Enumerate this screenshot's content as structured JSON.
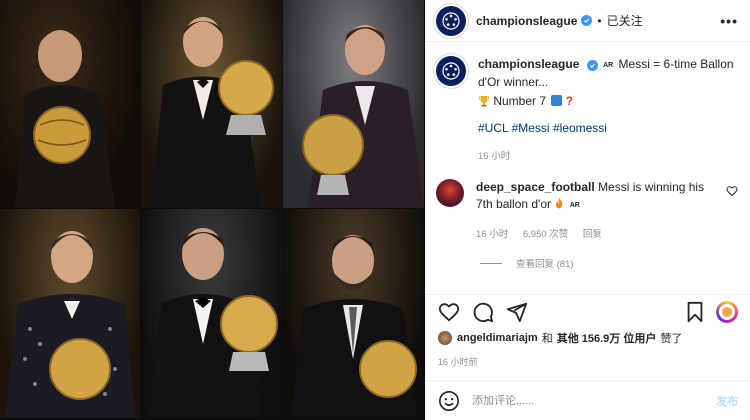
{
  "post": {
    "username": "championsleague",
    "follow_label": "已关注",
    "more_label": "•••"
  },
  "caption": {
    "username": "championsleague",
    "text_line1": "Messi = 6-time Ballon d'Or winner...",
    "text_line2": "Number 7",
    "tags": [
      "#UCL",
      "#Messi",
      "#leomessi"
    ],
    "time": "16 小时"
  },
  "comment": {
    "username": "deep_space_football",
    "text": "Messi is winning his 7th ballon d'or",
    "time": "16 小时",
    "likes": "6,950 次赞",
    "reply_label": "回复",
    "view_replies": "查看回复 (81)"
  },
  "likes": {
    "username": "angeldimariajm",
    "and": "和",
    "others": "其他 156.9万 位用户",
    "liked": "赞了"
  },
  "post_time": "16 小时前",
  "add_comment": {
    "placeholder": "添加评论......",
    "post_label": "发布"
  },
  "colors": {
    "link": "#00376b",
    "verified": "#3897f0",
    "muted": "#8e8e8e",
    "post_disabled": "#b2dffc"
  },
  "icons": [
    "verified-icon",
    "heart-icon",
    "comment-icon",
    "share-icon",
    "save-icon",
    "emoji-icon",
    "more-icon",
    "trophy-icon",
    "fire-icon"
  ]
}
